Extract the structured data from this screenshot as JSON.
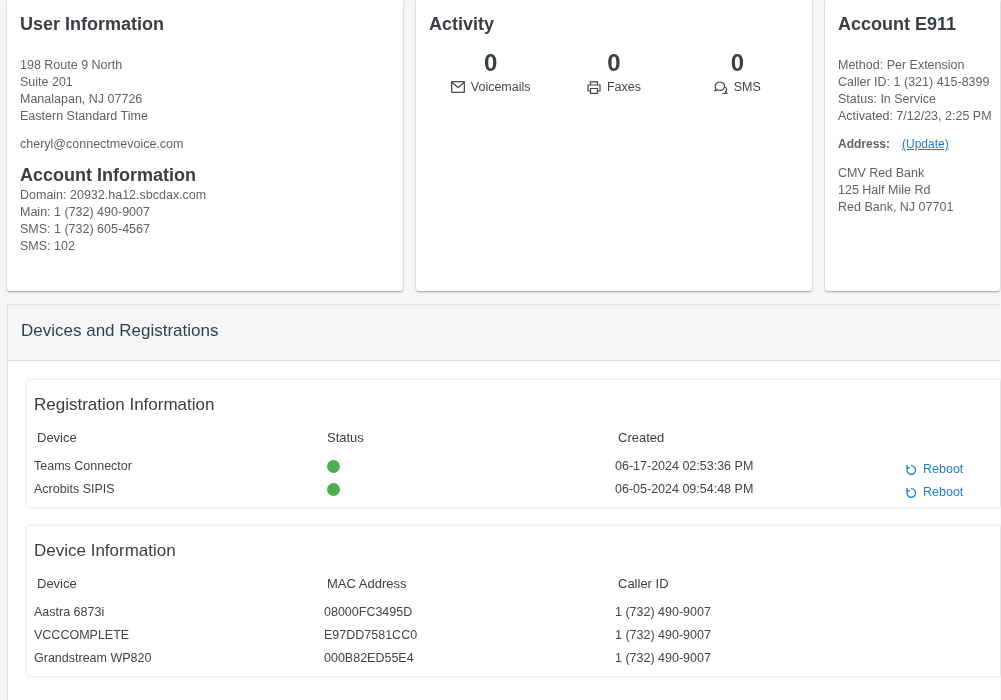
{
  "user_information": {
    "title": "User Information",
    "address_lines": [
      "198 Route 9 North",
      "Suite 201",
      "Manalapan, NJ 07726",
      "Eastern Standard Time"
    ],
    "email": "cheryl@connectmevoice.com"
  },
  "account_information": {
    "title": "Account Information",
    "lines": [
      "Domain: 20932.ha12.sbcdax.com",
      "Main: 1 (732) 490-9007",
      "SMS: 1 (732) 605-4567",
      "SMS: 102"
    ]
  },
  "activity": {
    "title": "Activity",
    "items": [
      {
        "kind": "voicemail",
        "count": "0",
        "label": "Voicemails"
      },
      {
        "kind": "fax",
        "count": "0",
        "label": "Faxes"
      },
      {
        "kind": "sms",
        "count": "0",
        "label": "SMS"
      }
    ]
  },
  "account_e911": {
    "title": "Account E911",
    "lines": [
      "Method: Per Extension",
      "Caller ID: 1 (321) 415-8399",
      "Status: In Service",
      "Activated: 7/12/23, 2:25 PM"
    ],
    "address_label": "Address:",
    "update_link": "(Update)",
    "address_lines": [
      "CMV Red Bank",
      "125 Half Mile Rd",
      "Red Bank, NJ 07701"
    ]
  },
  "devices_and_registrations": {
    "title": "Devices and Registrations",
    "registration_information": {
      "title": "Registration Information",
      "columns": [
        "Device",
        "Status",
        "Created"
      ],
      "rows": [
        {
          "device": "Teams Connector",
          "online": true,
          "created": "06-17-2024 02:53:36 PM",
          "action": "Reboot"
        },
        {
          "device": "Acrobits SIPIS",
          "online": true,
          "created": "06-05-2024 09:54:48 PM",
          "action": "Reboot"
        }
      ]
    },
    "device_information": {
      "title": "Device Information",
      "columns": [
        "Device",
        "MAC Address",
        "Caller ID"
      ],
      "rows": [
        [
          "Aastra 6873i",
          "08000FC3495D",
          "1 (732) 490-9007"
        ],
        [
          "VCCCOMPLETE",
          "E97DD7581CC0",
          "1 (732) 490-9007"
        ],
        [
          "Grandstream WP820",
          "000B82ED55E4",
          "1 (732) 490-9007"
        ]
      ]
    }
  }
}
